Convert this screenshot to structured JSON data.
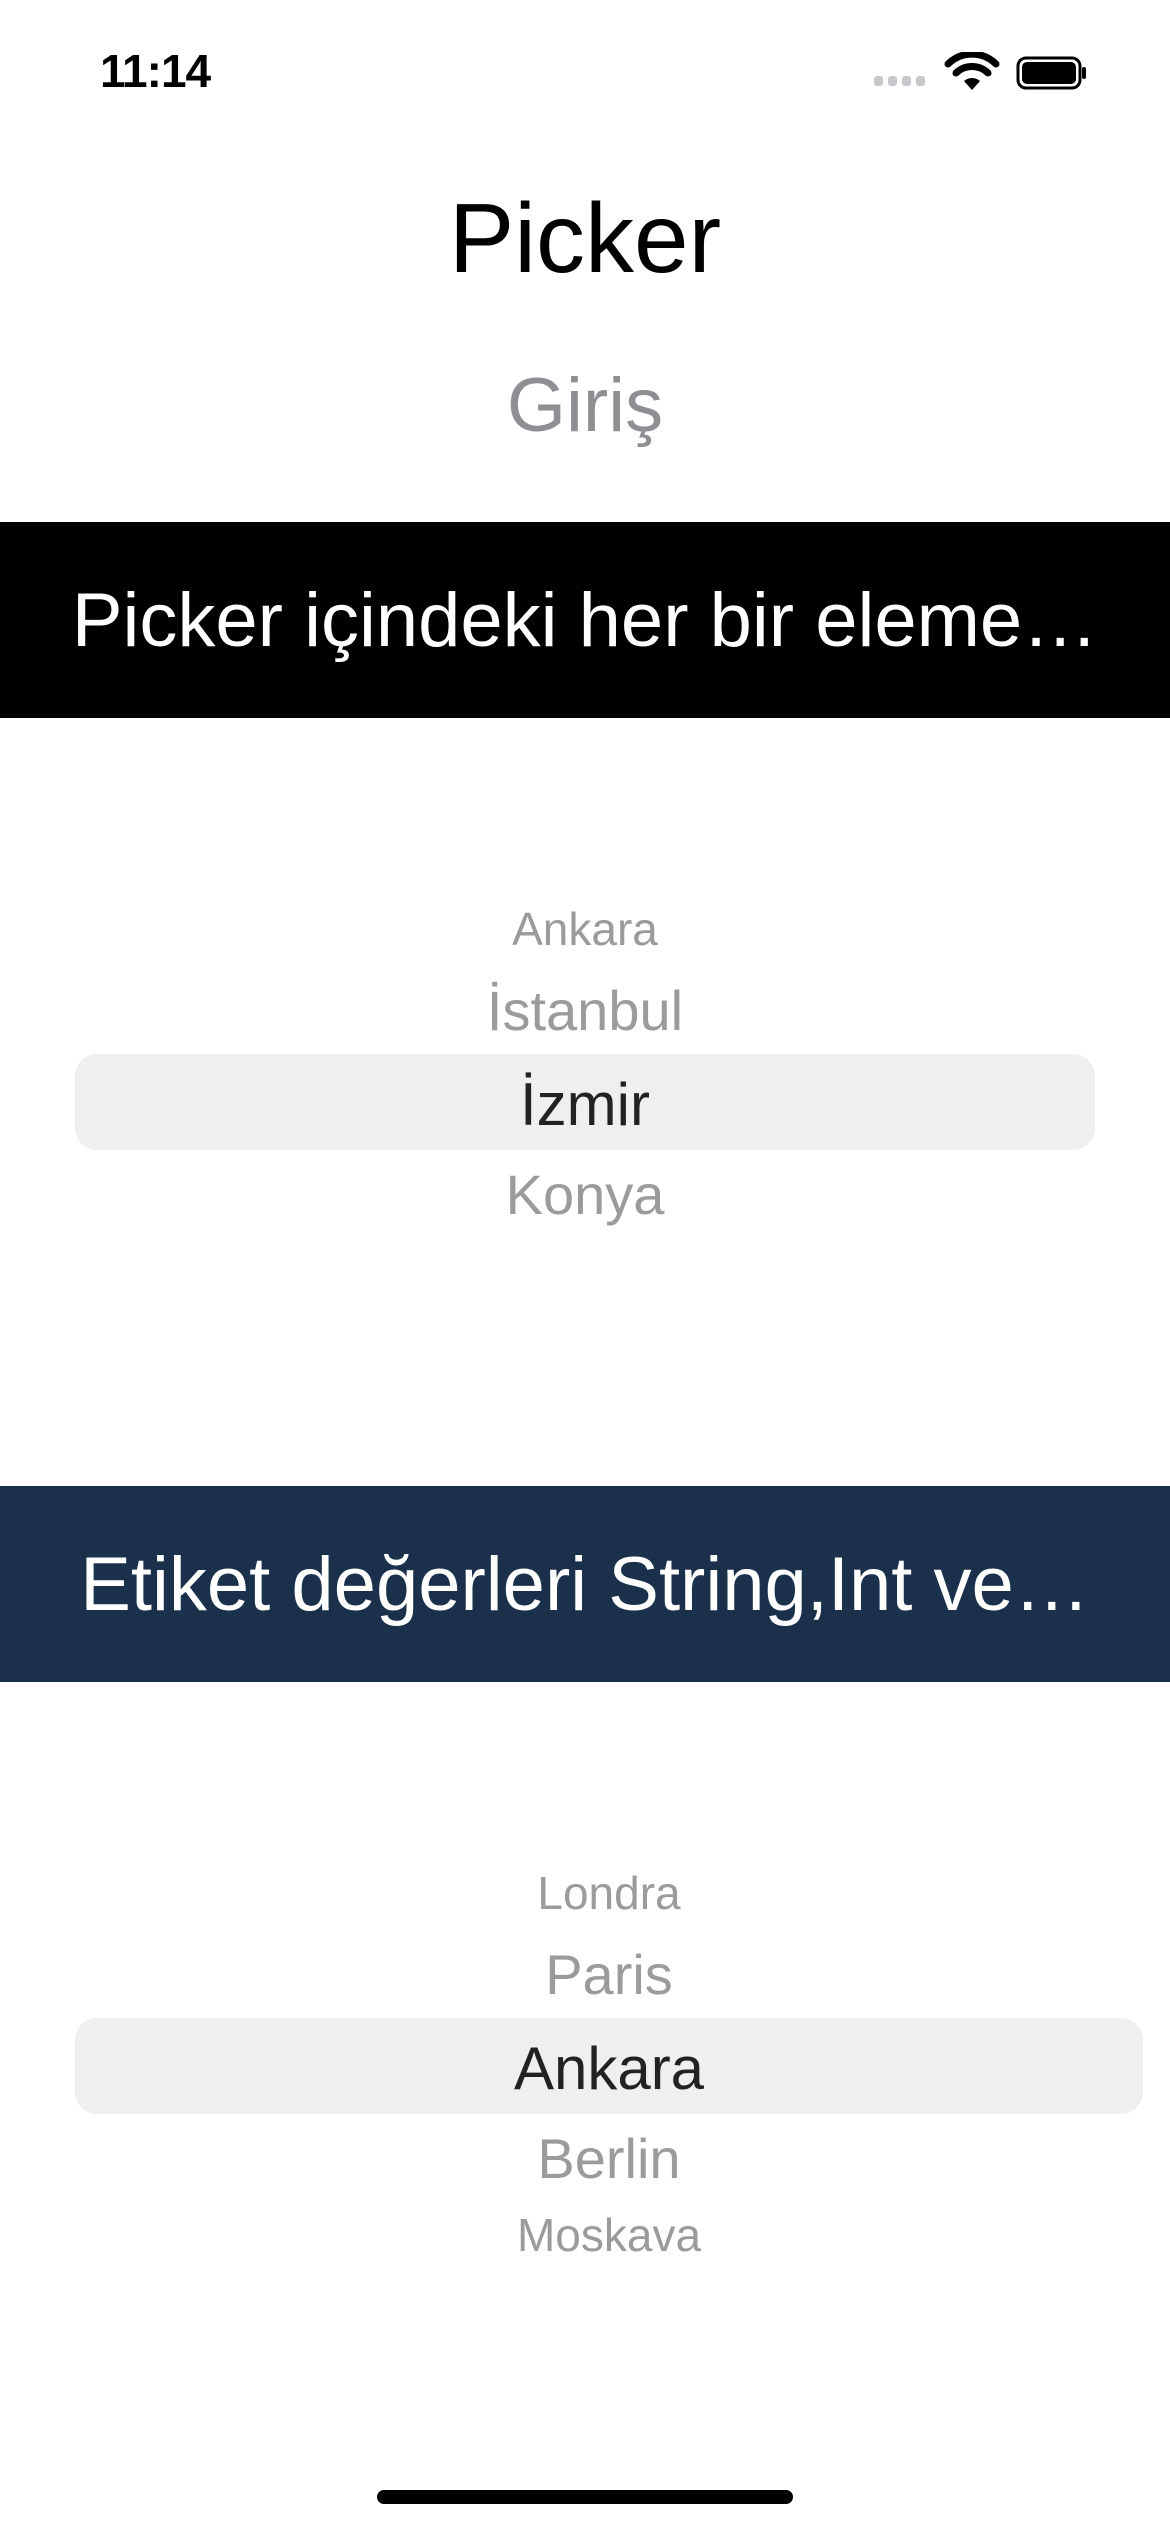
{
  "status_bar": {
    "time": "11:14",
    "icons": [
      "signal-icon",
      "wifi-icon",
      "battery-icon"
    ]
  },
  "header": {
    "title": "Picker",
    "subtitle": "Giriş"
  },
  "banners": [
    {
      "text": "Picker içindeki her bir eleme…",
      "background": "#000000"
    },
    {
      "text": "Etiket değerleri String,Int ve…",
      "background": "#1b314b"
    }
  ],
  "picker_cities_tr": {
    "items": [
      "Ankara",
      "İstanbul",
      "İzmir",
      "Konya"
    ],
    "selected": "İzmir"
  },
  "picker_capitals": {
    "items": [
      "Londra",
      "Paris",
      "Ankara",
      "Berlin",
      "Moskava"
    ],
    "selected": "Ankara"
  }
}
